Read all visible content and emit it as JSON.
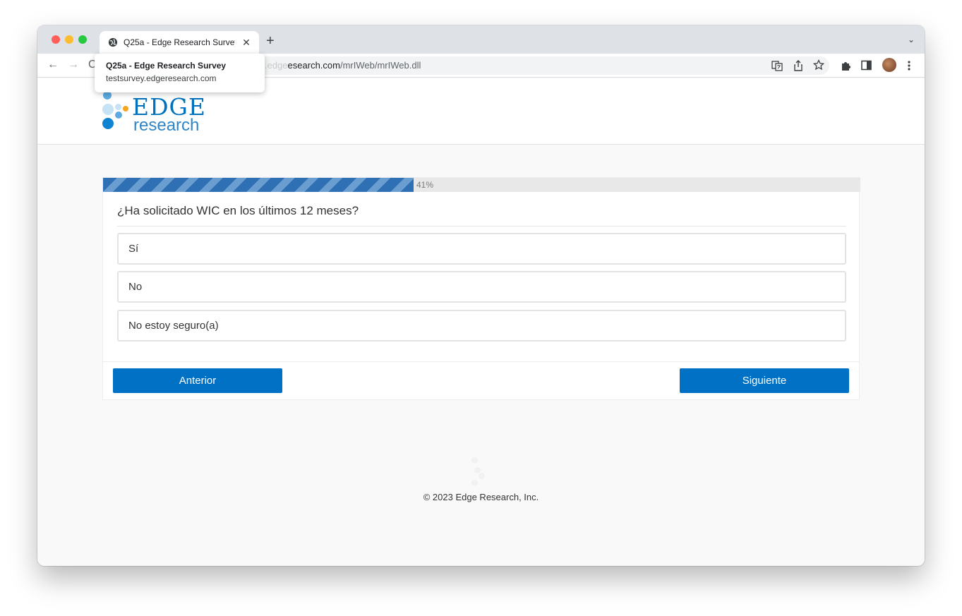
{
  "browser": {
    "tab_title": "Q25a - Edge Research Survey",
    "tab_close": "✕",
    "new_tab": "+",
    "tab_menu": "⌄",
    "url_host": "esearch.com",
    "url_host_faded": ".edge",
    "url_path": "/mrIWeb/mrIWeb.dll",
    "tooltip": {
      "title": "Q25a - Edge Research Survey",
      "host": "testsurvey.edgeresearch.com"
    },
    "icons": [
      "back-icon",
      "forward-icon",
      "reload-icon",
      "translate-icon",
      "share-icon",
      "bookmark-star-icon",
      "extensions-icon",
      "sidepanel-icon",
      "profile-avatar",
      "menu-kebab-icon"
    ]
  },
  "brand": {
    "logo_word": "EDGE",
    "logo_sub": "research",
    "colors": {
      "primary": "#0071bc",
      "button": "#0071c5",
      "dot_light": "#c6e2f5",
      "dot_mid": "#5da9e0",
      "dot_accent": "#f4a61d"
    }
  },
  "survey": {
    "progress_percent": 41,
    "progress_label": "41%",
    "question": "¿Ha solicitado WIC en los últimos 12 meses?",
    "options": [
      {
        "label": "Sí"
      },
      {
        "label": "No"
      },
      {
        "label": "No estoy seguro(a)"
      }
    ],
    "prev_label": "Anterior",
    "next_label": "Siguiente"
  },
  "footer": {
    "copyright": "© 2023 Edge Research, Inc."
  }
}
